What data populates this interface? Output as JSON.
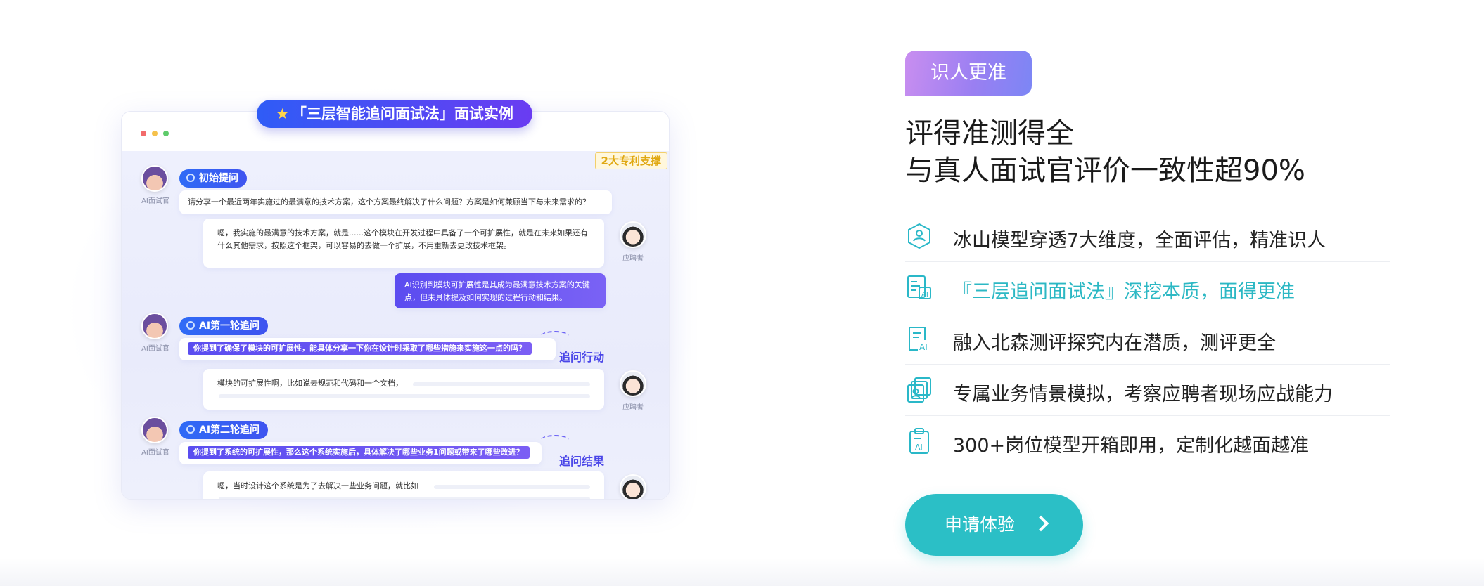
{
  "demo": {
    "title": "「三层智能追问面试法」面试实例",
    "patent_badge": "2大专利支撑",
    "ai_label": "AI面试官",
    "candidate_label": "应聘者",
    "steps": [
      {
        "pill": "初始提问",
        "question": "请分享一个最近两年实施过的最满意的技术方案，这个方案最终解决了什么问题？方案是如何兼顾当下与未来需求的？",
        "answer": "嗯，我实施的最满意的技术方案，就是......这个模块在开发过程中具备了一个可扩展性，就是在未来如果还有什么其他需求，按照这个框架，可以容易的去做一个扩展，不用重新去更改技术框架。",
        "ai_insight": "AI识别到模块可扩展性是其成为最满意技术方案的关键点，但未具体提及如何实现的过程行动和结果。"
      },
      {
        "pill": "AI第一轮追问",
        "question": "你提到了确保了模块的可扩展性，能具体分享一下你在设计时采取了哪些措施来实施这一点的吗？",
        "tag": "追问行动",
        "answer": "模块的可扩展性啊，比如说去规范和代码和一个文档，"
      },
      {
        "pill": "AI第二轮追问",
        "question": "你提到了系统的可扩展性，那么这个系统实施后，具体解决了哪些业务1问题或带来了哪些改进？",
        "tag": "追问结果",
        "answer": "嗯，当时设计这个系统是为了去解决一些业务问题，就比如"
      }
    ]
  },
  "right": {
    "tag": "识人更准",
    "headline_line1": "评得准测得全",
    "headline_line2": "与真人面试官评价一致性超90%",
    "features": [
      {
        "icon": "iceberg-model-icon",
        "text": "冰山模型穿透7大维度，全面评估，精准识人"
      },
      {
        "icon": "three-layer-ai-icon",
        "text": "『三层追问面试法』深挖本质，面得更准"
      },
      {
        "icon": "document-ai-icon",
        "text": "融入北森测评探究内在潜质，测评更全"
      },
      {
        "icon": "scenario-cards-icon",
        "text": "专属业务情景模拟，考察应聘者现场应战能力"
      },
      {
        "icon": "clipboard-ai-icon",
        "text": "300+岗位模型开箱即用，定制化越面越准"
      }
    ],
    "cta": "申请体验"
  },
  "colors": {
    "accent": "#2bbfc6",
    "accent_text": "#2cb8c4",
    "demo_blue": "#3f54f0",
    "demo_purple": "#6a3cf2"
  }
}
